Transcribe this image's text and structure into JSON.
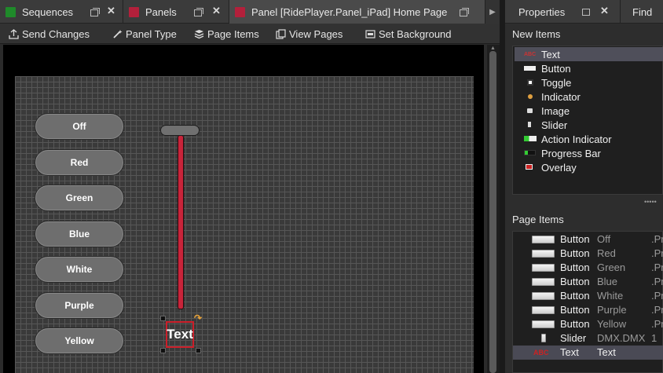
{
  "tabs": [
    {
      "label": "Sequences",
      "swatch": "#1f8a2a"
    },
    {
      "label": "Panels",
      "swatch": "#b3203b"
    },
    {
      "label": "Panel [RidePlayer.Panel_iPad] Home Page",
      "swatch": "#b3203b"
    }
  ],
  "toolbar": {
    "send_changes": "Send Changes",
    "panel_type": "Panel Type",
    "page_items": "Page Items",
    "view_pages": "View Pages",
    "set_background": "Set Background"
  },
  "canvas": {
    "buttons": [
      "Off",
      "Red",
      "Green",
      "Blue",
      "White",
      "Purple",
      "Yellow"
    ],
    "text_item": "Text",
    "slider_color": "#c8243a"
  },
  "right_panel": {
    "tab_properties": "Properties",
    "tab_find": "Find",
    "new_items_title": "New Items",
    "new_items": [
      {
        "label": "Text",
        "icon": "text-icon",
        "selected": true
      },
      {
        "label": "Button",
        "icon": "button-icon"
      },
      {
        "label": "Toggle",
        "icon": "toggle-icon"
      },
      {
        "label": "Indicator",
        "icon": "indicator-icon"
      },
      {
        "label": "Image",
        "icon": "image-icon"
      },
      {
        "label": "Slider",
        "icon": "slider-icon"
      },
      {
        "label": "Action Indicator",
        "icon": "action-indicator-icon"
      },
      {
        "label": "Progress Bar",
        "icon": "progress-bar-icon"
      },
      {
        "label": "Overlay",
        "icon": "overlay-icon"
      }
    ],
    "page_items_title": "Page Items",
    "page_items": [
      {
        "type": "Button",
        "name": "Off",
        "extra": ".Pr"
      },
      {
        "type": "Button",
        "name": "Red",
        "extra": ".Pr"
      },
      {
        "type": "Button",
        "name": "Green",
        "extra": ".Pr"
      },
      {
        "type": "Button",
        "name": "Blue",
        "extra": ".Pr"
      },
      {
        "type": "Button",
        "name": "White",
        "extra": ".Pr"
      },
      {
        "type": "Button",
        "name": "Purple",
        "extra": ".Pr"
      },
      {
        "type": "Button",
        "name": "Yellow",
        "extra": ".Pr"
      },
      {
        "type": "Slider",
        "name": "DMX.DMX",
        "extra": "1"
      },
      {
        "type": "Text",
        "name": "Text",
        "extra": "",
        "selected": true
      }
    ]
  }
}
